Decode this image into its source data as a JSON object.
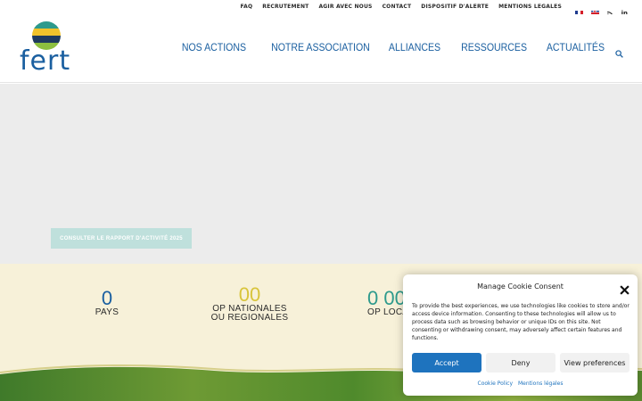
{
  "topnav": {
    "items": [
      "FAQ",
      "RECRUTEMENT",
      "AGIR AVEC NOUS",
      "CONTACT",
      "DISPOSITIF D'ALERTE",
      "MENTIONS LEGALES"
    ],
    "rss_icon": "rss-icon",
    "linkedin_label": "in"
  },
  "logo": {
    "text": "fert"
  },
  "mainnav": {
    "items": [
      "NOS ACTIONS",
      "NOTRE ASSOCIATION",
      "ALLIANCES",
      "RESSOURCES",
      "ACTUALITÉS"
    ]
  },
  "hero": {
    "button_label": "CONSULTER LE RAPPORT D'ACTIVITÉ 2025"
  },
  "stats": [
    {
      "number": "0",
      "label_line1": "PAYS",
      "label_line2": "",
      "color": "#1a5fa0"
    },
    {
      "number": "00",
      "label_line1": "OP NATIONALES",
      "label_line2": "OU REGIONALES",
      "color": "#d8c43a"
    },
    {
      "number": "0 00",
      "label_line1": "OP LOCA",
      "label_line2": "",
      "color": "#2d9a8c"
    }
  ],
  "cookie": {
    "title": "Manage Cookie Consent",
    "text": "To provide the best experiences, we use technologies like cookies to store and/or access device information. Consenting to these technologies will allow us to process data such as browsing behavior or unique IDs on this site. Not consenting or withdrawing consent, may adversely affect certain features and functions.",
    "accept": "Accept",
    "deny": "Deny",
    "preferences": "View preferences",
    "link_policy": "Cookie Policy",
    "link_legal": "Mentions légales"
  },
  "colors": {
    "brand_blue": "#1a5fa0",
    "accept_blue": "#1e73be",
    "stats_bg": "#f7f1d9",
    "hero_bg": "#ececec"
  }
}
